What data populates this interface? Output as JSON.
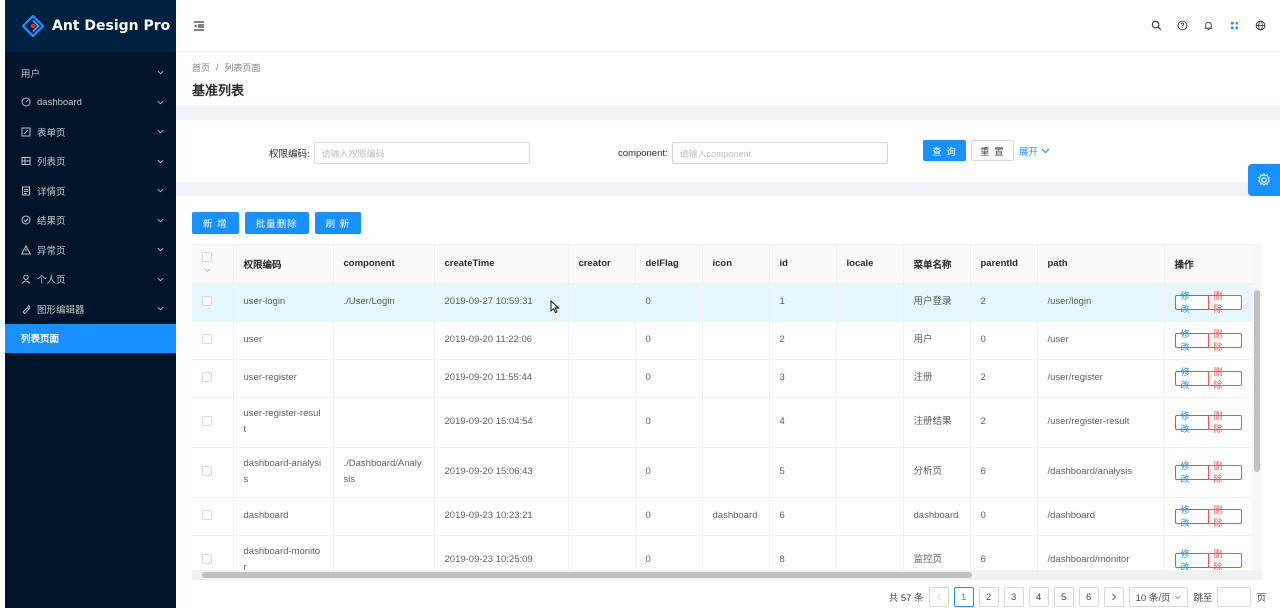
{
  "app": {
    "title": "Ant Design Pro"
  },
  "colors": {
    "primary": "#1890ff",
    "sider": "#001529",
    "danger": "#ff4d4f"
  },
  "sidebar": {
    "items": [
      {
        "label": "用户",
        "icon": "",
        "expandable": true,
        "active": false
      },
      {
        "label": "dashboard",
        "icon": "dashboard-icon",
        "expandable": true,
        "active": false
      },
      {
        "label": "表单页",
        "icon": "form-icon",
        "expandable": true,
        "active": false
      },
      {
        "label": "列表页",
        "icon": "table-icon",
        "expandable": true,
        "active": false
      },
      {
        "label": "详情页",
        "icon": "profile-icon",
        "expandable": true,
        "active": false
      },
      {
        "label": "结果页",
        "icon": "check-circle-icon",
        "expandable": true,
        "active": false
      },
      {
        "label": "异常页",
        "icon": "warning-icon",
        "expandable": true,
        "active": false
      },
      {
        "label": "个人页",
        "icon": "user-icon",
        "expandable": true,
        "active": false
      },
      {
        "label": "图形编辑器",
        "icon": "highlight-icon",
        "expandable": true,
        "active": false
      },
      {
        "label": "列表页面",
        "icon": "",
        "expandable": false,
        "active": true
      }
    ]
  },
  "header": {
    "icons": [
      "search-icon",
      "question-icon",
      "bell-icon",
      "apps-icon",
      "globe-icon"
    ]
  },
  "breadcrumb": {
    "home": "首页",
    "sep": "/",
    "current": "列表页面"
  },
  "page_title": "基准列表",
  "search": {
    "field1_label": "权限编码:",
    "field1_placeholder": "请输入权限编码",
    "field2_label": "component:",
    "field2_placeholder": "请输入component",
    "query_label": "查 询",
    "reset_label": "重 置",
    "expand_label": "展开"
  },
  "toolbar": {
    "add_label": "新 增",
    "batch_delete_label": "批量删除",
    "refresh_label": "刷 新"
  },
  "table": {
    "columns": [
      "权限编码",
      "component",
      "createTime",
      "creator",
      "delFlag",
      "icon",
      "id",
      "locale",
      "菜单名称",
      "parentId",
      "path",
      "操作"
    ],
    "rows": [
      {
        "code": "user-login",
        "component": "./User/Login",
        "createTime": "2019-09-27 10:59:31",
        "creator": "",
        "delFlag": "0",
        "icon": "",
        "id": "1",
        "locale": "",
        "name": "用户登录",
        "parentId": "2",
        "path": "/user/login",
        "highlight": true,
        "tall": false
      },
      {
        "code": "user",
        "component": "",
        "createTime": "2019-09-20 11:22:06",
        "creator": "",
        "delFlag": "0",
        "icon": "",
        "id": "2",
        "locale": "",
        "name": "用户",
        "parentId": "0",
        "path": "/user",
        "highlight": false,
        "tall": false
      },
      {
        "code": "user-register",
        "component": "",
        "createTime": "2019-09-20 11:55:44",
        "creator": "",
        "delFlag": "0",
        "icon": "",
        "id": "3",
        "locale": "",
        "name": "注册",
        "parentId": "2",
        "path": "/user/register",
        "highlight": false,
        "tall": false
      },
      {
        "code": "user-register-result",
        "component": "",
        "createTime": "2019-09-20 15:04:54",
        "creator": "",
        "delFlag": "0",
        "icon": "",
        "id": "4",
        "locale": "",
        "name": "注册结果",
        "parentId": "2",
        "path": "/user/register-result",
        "highlight": false,
        "tall": true
      },
      {
        "code": "dashboard-analysis",
        "component": "./Dashboard/Analysis",
        "createTime": "2019-09-20 15:06:43",
        "creator": "",
        "delFlag": "0",
        "icon": "",
        "id": "5",
        "locale": "",
        "name": "分析页",
        "parentId": "6",
        "path": "/dashboard/analysis",
        "highlight": false,
        "tall": true
      },
      {
        "code": "dashboard",
        "component": "",
        "createTime": "2019-09-23 10:23:21",
        "creator": "",
        "delFlag": "0",
        "icon": "dashboard",
        "id": "6",
        "locale": "",
        "name": "dashboard",
        "parentId": "0",
        "path": "/dashboard",
        "highlight": false,
        "tall": false
      },
      {
        "code": "dashboard-monitor",
        "component": "",
        "createTime": "2019-09-23 10:25:09",
        "creator": "",
        "delFlag": "0",
        "icon": "",
        "id": "8",
        "locale": "",
        "name": "监控页",
        "parentId": "6",
        "path": "/dashboard/monitor",
        "highlight": false,
        "tall": true
      }
    ],
    "edit_label": "修 改",
    "delete_label": "删 除"
  },
  "pagination": {
    "total_label": "共 57 条",
    "pages": [
      "1",
      "2",
      "3",
      "4",
      "5",
      "6"
    ],
    "current": "1",
    "page_size_label": "10 条/页",
    "jump_label": "跳至",
    "page_suffix": "页"
  }
}
